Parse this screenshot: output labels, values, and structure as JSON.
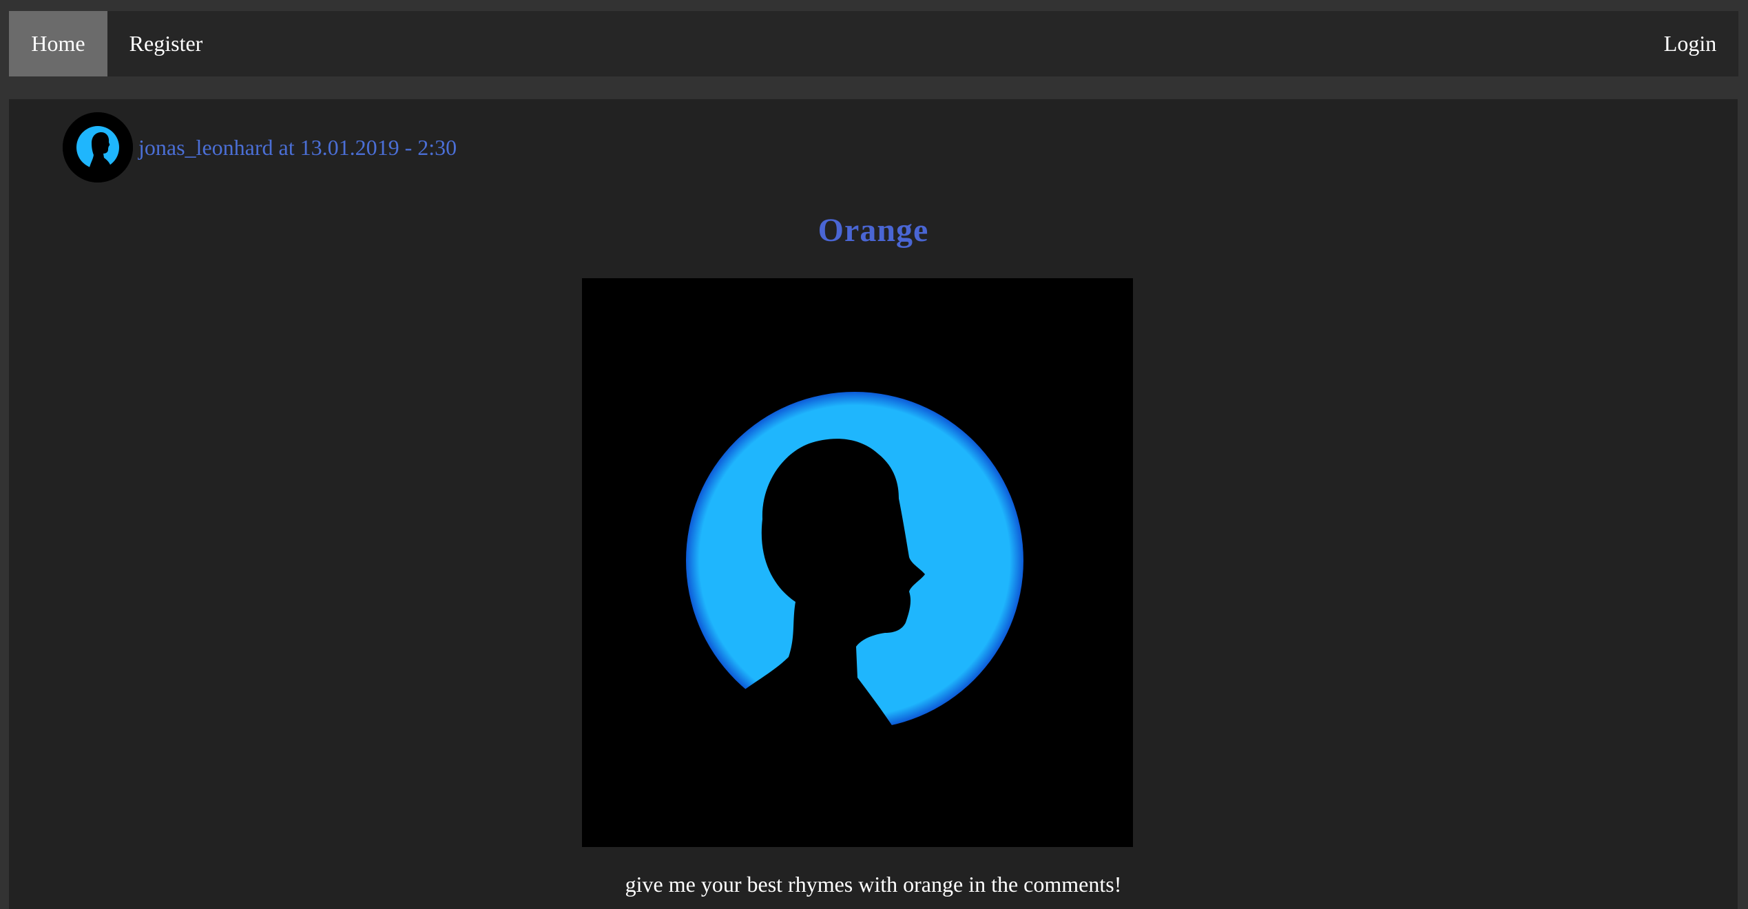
{
  "nav": {
    "home_label": "Home",
    "register_label": "Register",
    "login_label": "Login"
  },
  "post": {
    "author_line": "jonas_leonhard at 13.01.2019 - 2:30",
    "title": "Orange",
    "body": "give me your best rhymes with orange in the comments!"
  },
  "colors": {
    "page_background": "#333333",
    "navbar_background": "#262626",
    "active_nav_background": "#6b6b6b",
    "post_background": "#222222",
    "author_link": "#4b6fd6",
    "title": "#4a66d4",
    "image_circle": "#1fb6fd",
    "text": "#ffffff"
  },
  "icons": {
    "avatar": "silhouette-avatar-icon"
  }
}
